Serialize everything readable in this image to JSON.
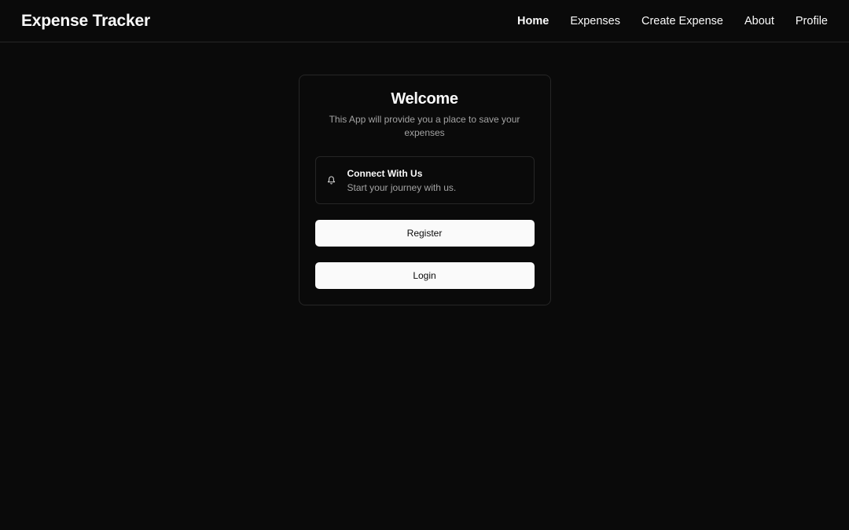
{
  "app": {
    "brand": "Expense Tracker"
  },
  "nav": {
    "items": [
      {
        "label": "Home",
        "active": true
      },
      {
        "label": "Expenses",
        "active": false
      },
      {
        "label": "Create Expense",
        "active": false
      },
      {
        "label": "About",
        "active": false
      },
      {
        "label": "Profile",
        "active": false
      }
    ]
  },
  "card": {
    "title": "Welcome",
    "description": "This App will provide you a place to save your expenses",
    "notice": {
      "icon": "bell-icon",
      "title": "Connect With Us",
      "subtitle": "Start your journey with us."
    },
    "buttons": {
      "register": "Register",
      "login": "Login"
    }
  },
  "colors": {
    "background": "#0a0a0a",
    "border": "#262626",
    "foreground": "#fafafa",
    "muted": "#a3a3a3"
  }
}
